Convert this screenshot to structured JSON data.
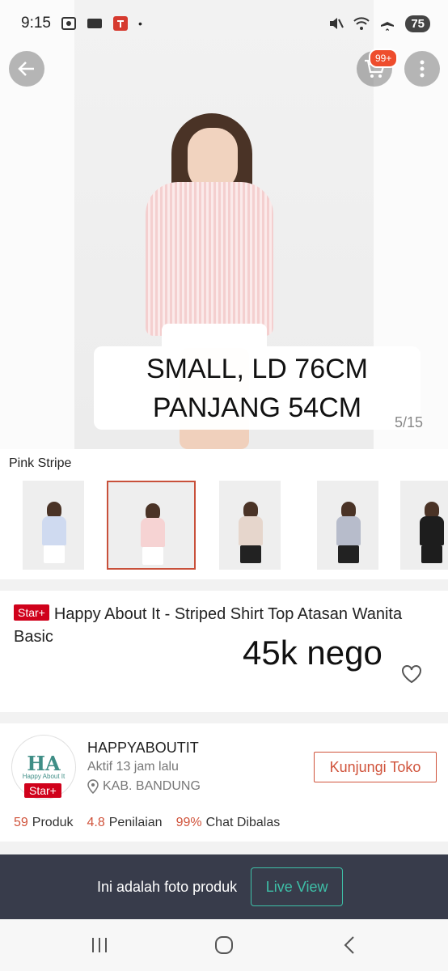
{
  "status_bar": {
    "time": "9:15",
    "battery": "75",
    "icons": [
      "screenshot-icon",
      "card-icon",
      "app-notification-icon",
      "dot-icon",
      "mute-icon",
      "wifi-icon",
      "airplane-icon"
    ]
  },
  "hero": {
    "overlay_line1": "SMALL, LD 76CM",
    "overlay_line2": "PANJANG 54CM",
    "image_counter": "5/15",
    "cart_badge": "99+"
  },
  "variant": {
    "label": "Pink Stripe",
    "thumbnails": [
      {
        "name": "blue-stripe",
        "top": "#cfdaf0",
        "bottom": "#ffffff"
      },
      {
        "name": "pink-stripe",
        "top": "#f6d3d3",
        "bottom": "#ffffff",
        "selected": true
      },
      {
        "name": "beige-stripe",
        "top": "#e6d6cc",
        "bottom": "#222222"
      },
      {
        "name": "grey-stripe",
        "top": "#b7bccb",
        "bottom": "#222222"
      },
      {
        "name": "black",
        "top": "#1d1d1d",
        "bottom": "#1d1d1d"
      }
    ]
  },
  "product": {
    "badge": "Star+",
    "title": "Happy About It - Striped Shirt Top Atasan Wanita Basic",
    "price_overlay": "45k nego"
  },
  "shop": {
    "name": "HAPPYABOUTIT",
    "active": "Aktif 13 jam lalu",
    "location": "KAB. BANDUNG",
    "badge": "Star+",
    "logo_text": "HA",
    "logo_sub": "Happy About It",
    "visit_label": "Kunjungi Toko",
    "stats": {
      "products_num": "59",
      "products_label": "Produk",
      "rating_num": "4.8",
      "rating_label": "Penilaian",
      "chat_num": "99%",
      "chat_label": "Chat Dibalas"
    }
  },
  "live_bar": {
    "text": "Ini adalah foto produk",
    "button": "Live View"
  },
  "colors": {
    "accent": "#d0533b",
    "badge_red": "#d0011b",
    "live_bar_bg": "#383c4b",
    "live_accent": "#3ec0a8"
  }
}
